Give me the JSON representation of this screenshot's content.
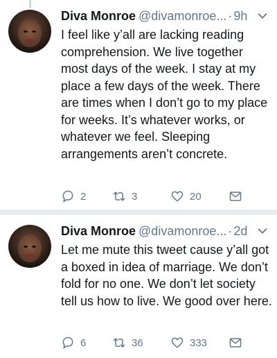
{
  "tweets": [
    {
      "display_name": "Diva Monroe",
      "handle": "@divamonroe...",
      "time": "9h",
      "text": "I feel like y’all are lacking reading comprehension. We live together most days of the week. I stay at my place a few days of the week. There are times when I don’t go to my place for weeks. It’s whatever works, or whatever we feel. Sleeping arrangements aren’t concrete.",
      "replies": "2",
      "retweets": "3",
      "likes": "20"
    },
    {
      "display_name": "Diva Monroe",
      "handle": "@divamonroe...",
      "time": "2d",
      "text": "Let me mute this tweet cause y’all got a boxed in idea of marriage. We don’t fold for no one. We don’t let society tell us how to live. We good over here.",
      "replies": "6",
      "retweets": "36",
      "likes": "333"
    }
  ],
  "icons": {
    "reply": "reply-icon",
    "retweet": "retweet-icon",
    "like": "heart-icon",
    "message": "envelope-icon",
    "menu": "chevron-down-icon"
  },
  "colors": {
    "text": "#14171a",
    "secondary": "#657786",
    "separator": "#e6ecf0"
  }
}
